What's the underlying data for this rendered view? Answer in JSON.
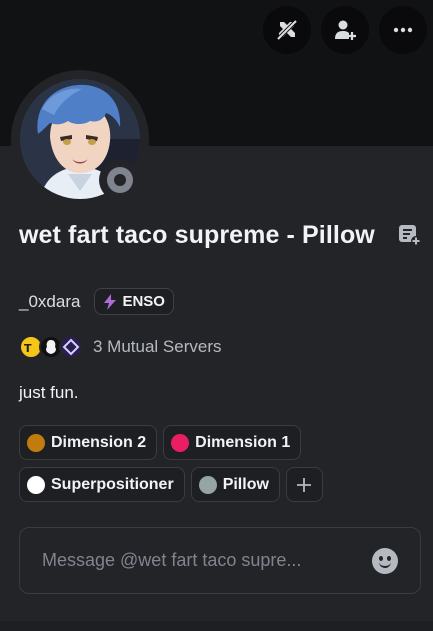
{
  "profile": {
    "display_name": "wet fart taco supreme - Pillow",
    "username": "_0xdara",
    "clan_tag": "ENSO",
    "mutual_servers": "3 Mutual Servers",
    "bio": "just fun.",
    "status": "offline"
  },
  "top_actions": [
    {
      "icon": "no-swords-icon"
    },
    {
      "icon": "add-friend-icon"
    },
    {
      "icon": "more-options-icon"
    }
  ],
  "roles": [
    {
      "name": "Dimension 2",
      "color": "#c27c0e"
    },
    {
      "name": "Dimension 1",
      "color": "#e91e63"
    },
    {
      "name": "Superpositioner",
      "color": "#ffffff"
    },
    {
      "name": "Pillow",
      "color": "#95a5a6"
    }
  ],
  "message": {
    "placeholder": "Message @wet fart taco supre..."
  },
  "colors": {
    "banner": "#111214",
    "card": "#232428",
    "tag_icon": "#b06ad8"
  }
}
